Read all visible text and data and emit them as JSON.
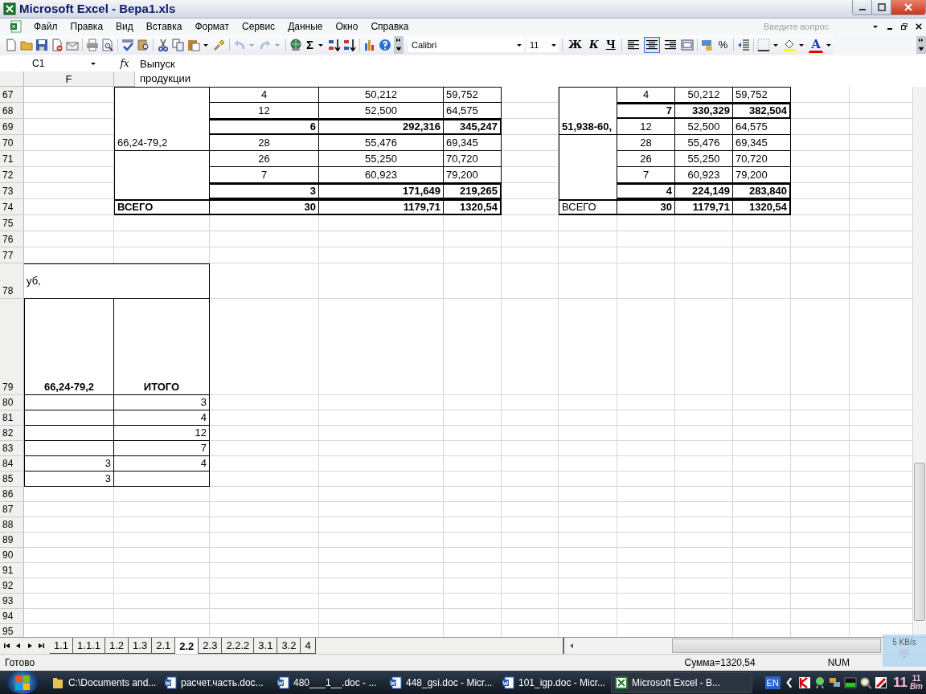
{
  "window": {
    "title": "Microsoft Excel - Вера1.xls"
  },
  "menu": [
    "Файл",
    "Правка",
    "Вид",
    "Вставка",
    "Формат",
    "Сервис",
    "Данные",
    "Окно",
    "Справка"
  ],
  "help_box": {
    "placeholder": "Введите вопрос"
  },
  "standard_toolbar": {
    "sum_label": "Σ",
    "undo": {
      "disabled": true
    },
    "redo": {
      "disabled": true
    }
  },
  "formatting_toolbar": {
    "font": "Calibri",
    "size": "11",
    "bold_label": "Ж",
    "italic_label": "К",
    "underline_label": "Ч",
    "alignment": [
      {
        "selected": false
      },
      {
        "selected": true
      },
      {
        "selected": false
      }
    ],
    "percent_label": "%",
    "font_color_label": "A"
  },
  "formula_bar": {
    "name_box": "C1",
    "function_label": "fx",
    "content_lines": [
      "Выпуск",
      "продукции"
    ]
  },
  "columns": [
    {
      "label": "F"
    }
  ],
  "rows": [
    "67",
    "68",
    "69",
    "70",
    "71",
    "72",
    "73",
    "74",
    "75",
    "76",
    "77",
    "78",
    "79",
    "80",
    "81",
    "82",
    "83",
    "84",
    "85",
    "86",
    "87",
    "88",
    "89",
    "90",
    "91",
    "92",
    "93",
    "94",
    "95"
  ],
  "tables": [
    {
      "rows": [
        {
          "kind": "item",
          "cells": [
            {},
            {
              "text": "4",
              "bold": false
            },
            {
              "text": "50,212",
              "bold": false
            },
            {
              "text": "59,752",
              "bold": false
            }
          ]
        },
        {
          "kind": "item",
          "cells": [
            {},
            {
              "text": "12",
              "bold": false
            },
            {
              "text": "52,500",
              "bold": false
            },
            {
              "text": "64,575",
              "bold": false
            }
          ]
        },
        {
          "kind": "subtotal",
          "cells": [
            {},
            {
              "text": "6",
              "bold": true
            },
            {
              "text": "292,316",
              "bold": true
            },
            {
              "text": "345,247",
              "bold": true
            }
          ]
        },
        {
          "kind": "item",
          "cells": [
            {
              "text": "66,24-79,2",
              "bold": false
            },
            {
              "text": "28",
              "bold": false
            },
            {
              "text": "55,476",
              "bold": false
            },
            {
              "text": "69,345",
              "bold": false
            }
          ]
        },
        {
          "kind": "item",
          "cells": [
            {},
            {
              "text": "26",
              "bold": false
            },
            {
              "text": "55,250",
              "bold": false
            },
            {
              "text": "70,720",
              "bold": false
            }
          ]
        },
        {
          "kind": "item",
          "cells": [
            {},
            {
              "text": "7",
              "bold": false
            },
            {
              "text": "60,923",
              "bold": false
            },
            {
              "text": "79,200",
              "bold": false
            }
          ]
        },
        {
          "kind": "subtotal",
          "cells": [
            {},
            {
              "text": "3",
              "bold": true
            },
            {
              "text": "171,649",
              "bold": true
            },
            {
              "text": "219,265",
              "bold": true
            }
          ]
        },
        {
          "kind": "total",
          "cells": [
            {
              "text": "ВСЕГО",
              "bold": true
            },
            {
              "text": "30",
              "bold": true
            },
            {
              "text": "1179,71",
              "bold": true
            },
            {
              "text": "1320,54",
              "bold": true
            }
          ]
        }
      ]
    },
    {
      "rows": [
        {
          "kind": "item",
          "cells": [
            {},
            {
              "text": "4",
              "bold": false
            },
            {
              "text": "50,212",
              "bold": false
            },
            {
              "text": "59,752",
              "bold": false
            }
          ]
        },
        {
          "kind": "subtotal",
          "cells": [
            {},
            {
              "text": "7",
              "bold": true
            },
            {
              "text": "330,329",
              "bold": true
            },
            {
              "text": "382,504",
              "bold": true
            }
          ]
        },
        {
          "kind": "item",
          "cells": [
            {
              "text": "51,938-60,",
              "bold": true
            },
            {
              "text": "12",
              "bold": false
            },
            {
              "text": "52,500",
              "bold": false
            },
            {
              "text": "64,575",
              "bold": false
            }
          ]
        },
        {
          "kind": "item",
          "cells": [
            {},
            {
              "text": "28",
              "bold": false
            },
            {
              "text": "55,476",
              "bold": false
            },
            {
              "text": "69,345",
              "bold": false
            }
          ]
        },
        {
          "kind": "item",
          "cells": [
            {},
            {
              "text": "26",
              "bold": false
            },
            {
              "text": "55,250",
              "bold": false
            },
            {
              "text": "70,720",
              "bold": false
            }
          ]
        },
        {
          "kind": "item",
          "cells": [
            {},
            {
              "text": "7",
              "bold": false
            },
            {
              "text": "60,923",
              "bold": false
            },
            {
              "text": "79,200",
              "bold": false
            }
          ]
        },
        {
          "kind": "subtotal",
          "cells": [
            {},
            {
              "text": "4",
              "bold": true
            },
            {
              "text": "224,149",
              "bold": true
            },
            {
              "text": "283,840",
              "bold": true
            }
          ]
        },
        {
          "kind": "total",
          "cells": [
            {
              "text": "ВСЕГО",
              "bold": false
            },
            {
              "text": "30",
              "bold": true
            },
            {
              "text": "1179,71",
              "bold": true
            },
            {
              "text": "1320,54",
              "bold": true
            }
          ]
        }
      ]
    },
    {
      "rows": [
        {
          "kind": "caption",
          "cells": [
            {
              "text": "уб,",
              "bold": false
            }
          ]
        },
        {
          "kind": "heading",
          "cells": [
            {
              "text": "66,24-79,2",
              "bold": true
            },
            {
              "text": "ИТОГО",
              "bold": true
            }
          ]
        },
        {
          "kind": "item",
          "cells": [
            {},
            {
              "text": "3",
              "bold": false
            }
          ]
        },
        {
          "kind": "item",
          "cells": [
            {},
            {
              "text": "4",
              "bold": false
            }
          ]
        },
        {
          "kind": "item",
          "cells": [
            {},
            {
              "text": "12",
              "bold": false
            }
          ]
        },
        {
          "kind": "item",
          "cells": [
            {},
            {
              "text": "7",
              "bold": false
            }
          ]
        },
        {
          "kind": "item",
          "cells": [
            {
              "text": "3",
              "bold": false
            },
            {
              "text": "4",
              "bold": false
            }
          ]
        },
        {
          "kind": "item",
          "cells": [
            {
              "text": "3",
              "bold": false
            },
            {}
          ]
        }
      ]
    }
  ],
  "sheet_tabs": [
    {
      "label": "1.1",
      "selected": false
    },
    {
      "label": "1.1.1",
      "selected": false
    },
    {
      "label": "1.2",
      "selected": false
    },
    {
      "label": "1.3",
      "selected": false
    },
    {
      "label": "2.1",
      "selected": false
    },
    {
      "label": "2.2",
      "selected": true
    },
    {
      "label": "2.3",
      "selected": false
    },
    {
      "label": "2.2.2",
      "selected": false
    },
    {
      "label": "3.1",
      "selected": false
    },
    {
      "label": "3.2",
      "selected": false
    },
    {
      "label": "4",
      "selected": false
    }
  ],
  "status_bar": {
    "status": "Готово",
    "sum": "Сумма=1320,54",
    "indicator": "NUM"
  },
  "network_meter": {
    "rate": "5 KB/s"
  },
  "taskbar": {
    "tasks": [
      {
        "label": "C:\\Documents and...",
        "kind": "folder",
        "selected": false
      },
      {
        "label": "расчет.часть.doc...",
        "kind": "word",
        "selected": false
      },
      {
        "label": "480___1__.doc - ...",
        "kind": "word",
        "selected": false
      },
      {
        "label": "448_gsi.doc - Micr...",
        "kind": "word",
        "selected": false
      },
      {
        "label": "101_igp.doc - Micr...",
        "kind": "word",
        "selected": false
      },
      {
        "label": "Microsoft Excel - В...",
        "kind": "excel",
        "selected": true
      }
    ],
    "language": "EN",
    "clock": {
      "hours": "11",
      "minutes": "11",
      "day": "Вт"
    }
  }
}
